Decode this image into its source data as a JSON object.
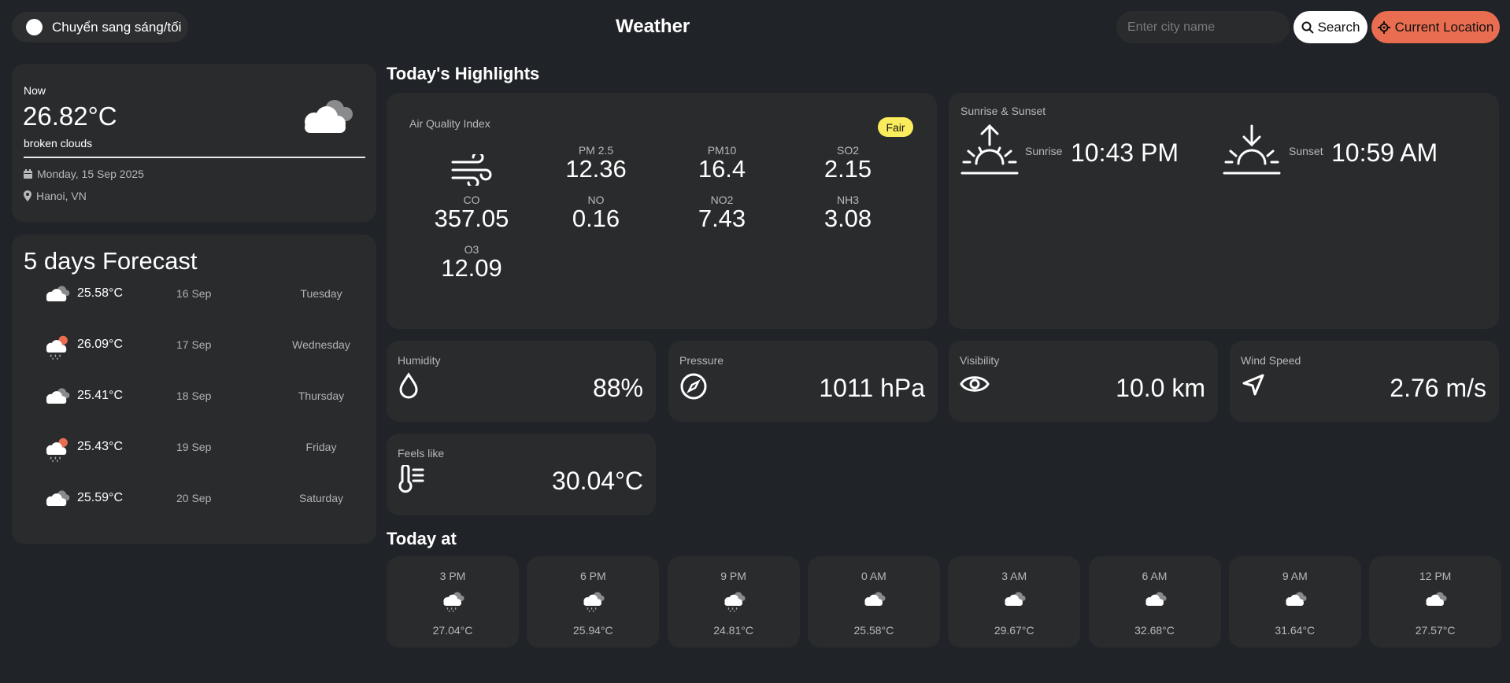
{
  "header": {
    "theme_toggle_label": "Chuyển sang sáng/tối",
    "title": "Weather",
    "search_placeholder": "Enter city name",
    "search_label": "Search",
    "location_label": "Current Location"
  },
  "now": {
    "label": "Now",
    "temp": "26.82°C",
    "description": "broken clouds",
    "icon": "broken-clouds-icon",
    "date": "Monday, 15 Sep 2025",
    "location": "Hanoi, VN"
  },
  "forecast": {
    "title": "5 days Forecast",
    "days": [
      {
        "temp": "25.58°C",
        "date": "16 Sep",
        "day": "Tuesday",
        "icon": "broken-clouds-icon"
      },
      {
        "temp": "26.09°C",
        "date": "17 Sep",
        "day": "Wednesday",
        "icon": "sun-rain-icon"
      },
      {
        "temp": "25.41°C",
        "date": "18 Sep",
        "day": "Thursday",
        "icon": "broken-clouds-icon"
      },
      {
        "temp": "25.43°C",
        "date": "19 Sep",
        "day": "Friday",
        "icon": "sun-rain-icon"
      },
      {
        "temp": "25.59°C",
        "date": "20 Sep",
        "day": "Saturday",
        "icon": "broken-clouds-icon"
      }
    ]
  },
  "highlights": {
    "title": "Today's Highlights",
    "aqi": {
      "label": "Air Quality Index",
      "badge": "Fair",
      "badge_color": "#fbec5d",
      "items": [
        {
          "key": "PM 2.5",
          "value": "12.36"
        },
        {
          "key": "PM10",
          "value": "16.4"
        },
        {
          "key": "SO2",
          "value": "2.15"
        },
        {
          "key": "CO",
          "value": "357.05"
        },
        {
          "key": "NO",
          "value": "0.16"
        },
        {
          "key": "NO2",
          "value": "7.43"
        },
        {
          "key": "NH3",
          "value": "3.08"
        },
        {
          "key": "O3",
          "value": "12.09"
        }
      ]
    },
    "sun": {
      "label": "Sunrise & Sunset",
      "sunrise_label": "Sunrise",
      "sunrise": "10:43 PM",
      "sunset_label": "Sunset",
      "sunset": "10:59 AM"
    },
    "humidity": {
      "label": "Humidity",
      "value": "88%"
    },
    "pressure": {
      "label": "Pressure",
      "value": "1011 hPa"
    },
    "visibility": {
      "label": "Visibility",
      "value": "10.0 km"
    },
    "wind": {
      "label": "Wind Speed",
      "value": "2.76 m/s"
    },
    "feels_like": {
      "label": "Feels like",
      "value": "30.04°C"
    }
  },
  "today": {
    "title": "Today at",
    "hours": [
      {
        "time": "3 PM",
        "temp": "27.04°C",
        "icon": "rain-clouds-icon"
      },
      {
        "time": "6 PM",
        "temp": "25.94°C",
        "icon": "rain-clouds-icon"
      },
      {
        "time": "9 PM",
        "temp": "24.81°C",
        "icon": "rain-clouds-icon"
      },
      {
        "time": "0 AM",
        "temp": "25.58°C",
        "icon": "broken-clouds-icon"
      },
      {
        "time": "3 AM",
        "temp": "29.67°C",
        "icon": "broken-clouds-icon"
      },
      {
        "time": "6 AM",
        "temp": "32.68°C",
        "icon": "broken-clouds-icon"
      },
      {
        "time": "9 AM",
        "temp": "31.64°C",
        "icon": "broken-clouds-icon"
      },
      {
        "time": "12 PM",
        "temp": "27.57°C",
        "icon": "broken-clouds-icon"
      }
    ]
  },
  "colors": {
    "background": "#202328",
    "card": "#2a2b2d",
    "accent": "#e96d50"
  }
}
